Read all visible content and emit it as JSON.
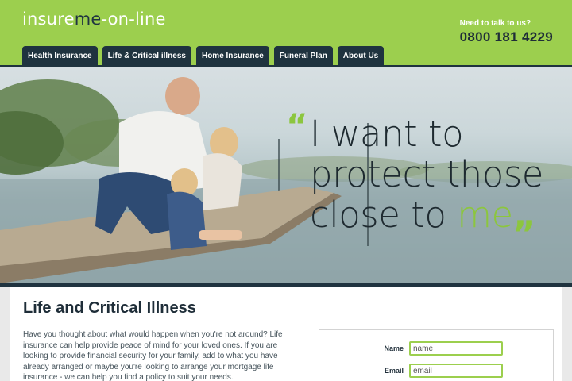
{
  "brand": {
    "logo_part1": "insure",
    "logo_part2": "me",
    "logo_part3": "-on-line"
  },
  "contact": {
    "label": "Need to talk to us?",
    "phone": "0800 181 4229"
  },
  "nav": {
    "items": [
      {
        "label": "Health Insurance"
      },
      {
        "label": "Life & Critical illness"
      },
      {
        "label": "Home Insurance"
      },
      {
        "label": "Funeral Plan"
      },
      {
        "label": "About Us"
      }
    ]
  },
  "hero": {
    "quote_open": "“",
    "line1": "I want to",
    "line2": "protect those",
    "line3_start": "close to ",
    "line3_accent": "me",
    "quote_close": "„"
  },
  "main": {
    "title": "Life and Critical Illness",
    "intro": "Have you thought about what would happen when you're not around? Life insurance can help provide peace of mind for your loved ones. If you are looking to provide financial security for your family, add to what you have already arranged or maybe you're looking to arrange your mortgage life insurance - we can help you find a policy to suit your needs."
  },
  "form": {
    "name_label": "Name",
    "name_placeholder": "name",
    "email_label": "Email",
    "email_placeholder": "email"
  },
  "colors": {
    "brand_green": "#9ccf4e",
    "navy": "#1f333f",
    "accent_green": "#8cc63e"
  }
}
